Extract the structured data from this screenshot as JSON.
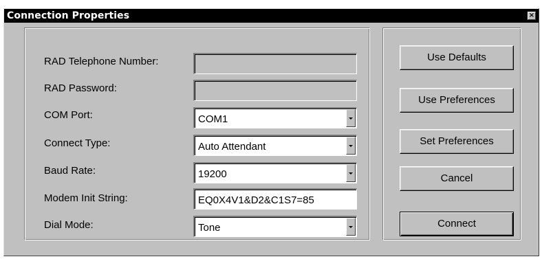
{
  "window": {
    "title": "Connection Properties",
    "close_glyph": "×"
  },
  "form": {
    "rad_telephone_number": {
      "label": "RAD Telephone Number:",
      "value": ""
    },
    "rad_password": {
      "label": "RAD Password:",
      "value": ""
    },
    "com_port": {
      "label": "COM Port:",
      "value": "COM1"
    },
    "connect_type": {
      "label": "Connect Type:",
      "value": "Auto Attendant"
    },
    "baud_rate": {
      "label": "Baud Rate:",
      "value": "19200"
    },
    "modem_init_string": {
      "label": "Modem Init String:",
      "value": "EQ0X4V1&D2&C1S7=85"
    },
    "dial_mode": {
      "label": "Dial Mode:",
      "value": "Tone"
    }
  },
  "buttons": {
    "use_defaults": "Use Defaults",
    "use_preferences": "Use Preferences",
    "set_preferences": "Set Preferences",
    "cancel": "Cancel",
    "connect": "Connect"
  },
  "icons": {
    "dropdown": "chevron-down-icon",
    "close": "close-icon"
  },
  "colors": {
    "face": "#c0c0c0",
    "titlebar": "#000000",
    "field": "#ffffff"
  }
}
